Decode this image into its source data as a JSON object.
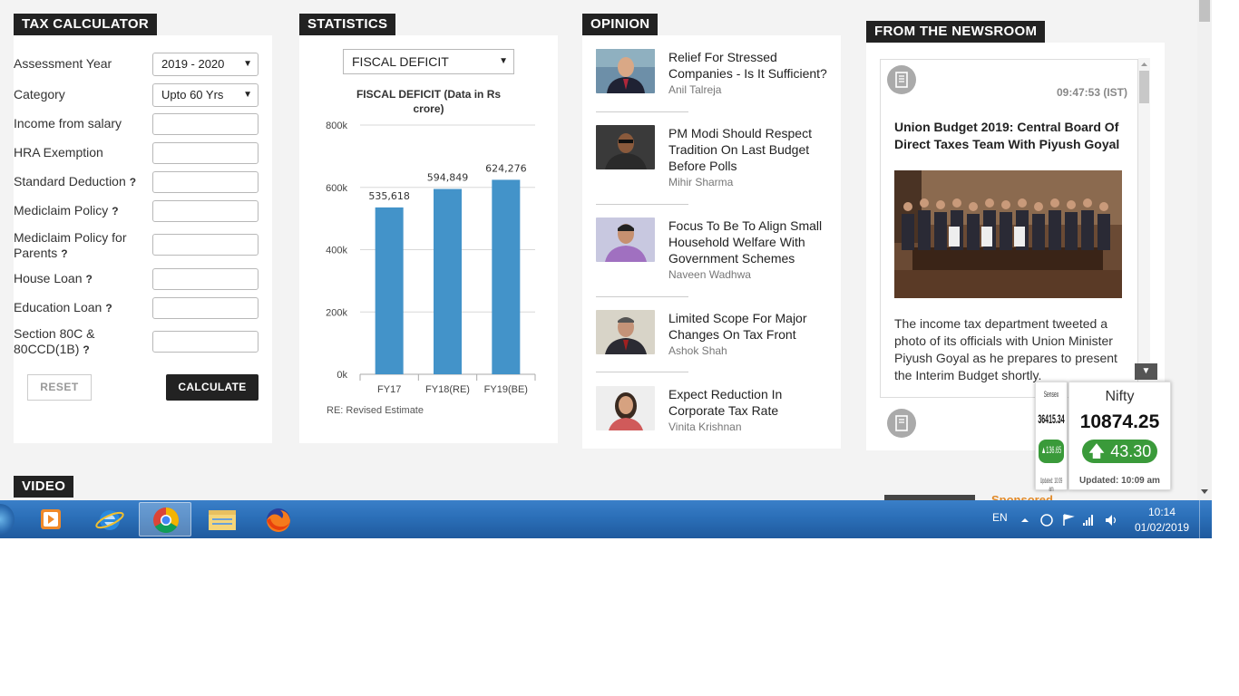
{
  "tax_calculator": {
    "title": "TAX CALCULATOR",
    "fields": [
      {
        "label": "Assessment Year",
        "value": "2019 - 2020",
        "type": "select"
      },
      {
        "label": "Category",
        "value": "Upto 60 Yrs",
        "type": "select"
      },
      {
        "label": "Income from salary",
        "value": "",
        "type": "input"
      },
      {
        "label": "HRA Exemption",
        "value": "",
        "type": "input"
      },
      {
        "label": "Standard Deduction",
        "value": "",
        "type": "input",
        "help": "?"
      },
      {
        "label": "Mediclaim Policy",
        "value": "",
        "type": "input",
        "help": "?"
      },
      {
        "label": "Mediclaim Policy for Parents",
        "value": "",
        "type": "input",
        "help": "?"
      },
      {
        "label": "House Loan",
        "value": "",
        "type": "input",
        "help": "?"
      },
      {
        "label": "Education Loan",
        "value": "",
        "type": "input",
        "help": "?"
      },
      {
        "label": "Section 80C & 80CCD(1B)",
        "value": "",
        "type": "input",
        "help": "?"
      }
    ],
    "reset_label": "RESET",
    "calculate_label": "CALCULATE"
  },
  "statistics": {
    "title": "STATISTICS",
    "selected": "FISCAL DEFICIT",
    "chart_title": "FISCAL DEFICIT (Data in Rs crore)",
    "note": "RE: Revised Estimate"
  },
  "chart_data": {
    "type": "bar",
    "title": "FISCAL DEFICIT (Data in Rs crore)",
    "categories": [
      "FY17",
      "FY18(RE)",
      "FY19(BE)"
    ],
    "values": [
      535618,
      594849,
      624276
    ],
    "value_labels": [
      "535,618",
      "594,849",
      "624,276"
    ],
    "ylim": [
      0,
      800000
    ],
    "yticks": [
      "0k",
      "200k",
      "400k",
      "600k",
      "800k"
    ],
    "ytick_values": [
      0,
      200000,
      400000,
      600000,
      800000
    ],
    "bar_color": "#4393c9",
    "grid": true
  },
  "opinion": {
    "title": "OPINION",
    "items": [
      {
        "title": "Relief For Stressed Companies - Is It Sufficient?",
        "author": "Anil Talreja"
      },
      {
        "title": "PM Modi Should Respect Tradition On Last Budget Before Polls",
        "author": "Mihir Sharma"
      },
      {
        "title": "Focus To Be To Align Small Household Welfare With Government Schemes",
        "author": "Naveen Wadhwa"
      },
      {
        "title": "Limited Scope For Major Changes On Tax Front",
        "author": "Ashok Shah"
      },
      {
        "title": "Expect Reduction In Corporate Tax Rate",
        "author": "Vinita Krishnan"
      }
    ]
  },
  "newsroom": {
    "title": "FROM THE NEWSROOM",
    "time": "09:47:53 (IST)",
    "headline": "Union Budget 2019: Central Board Of Direct Taxes Team With Piyush Goyal",
    "body": "The income tax department tweeted a photo of its officials with Union Minister Piyush Goyal as he prepares to present the Interim Budget shortly."
  },
  "ticker": {
    "sensex_name": "Sensex",
    "sensex_value": "36415.34",
    "sensex_change": "136.65",
    "sensex_updated": "Updated: 10:09 am",
    "nifty_name": "Nifty",
    "nifty_value": "10874.25",
    "nifty_change": "43.30",
    "nifty_updated": "Updated: 10:09 am"
  },
  "video": {
    "title": "VIDEO"
  },
  "sponsored": {
    "label": "Sponsored"
  },
  "taskbar": {
    "apps": [
      "windows-media-player",
      "internet-explorer",
      "chrome",
      "file-explorer",
      "firefox"
    ],
    "language": "EN",
    "time": "10:14",
    "date": "01/02/2019"
  }
}
